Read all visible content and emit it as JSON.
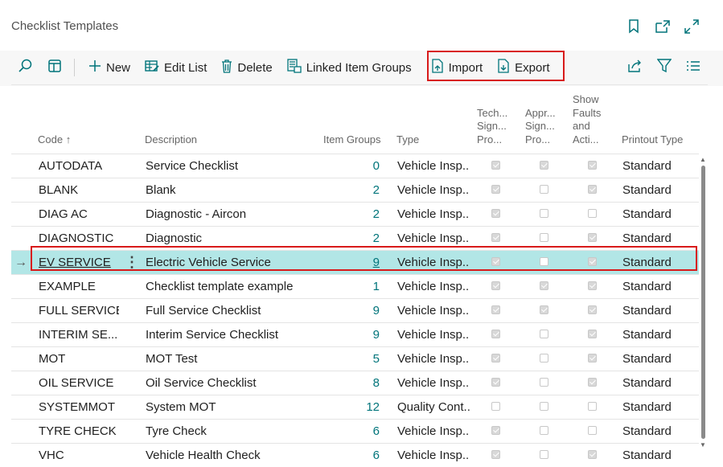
{
  "page": {
    "title": "Checklist Templates"
  },
  "title_icons": [
    "bookmark-icon",
    "open-new-window-icon",
    "expand-icon"
  ],
  "toolbar": {
    "new_label": "New",
    "edit_list_label": "Edit List",
    "delete_label": "Delete",
    "linked_item_groups_label": "Linked Item Groups",
    "import_label": "Import",
    "export_label": "Export"
  },
  "columns": {
    "code": "Code ↑",
    "description": "Description",
    "item_groups": "Item Groups",
    "type": "Type",
    "tech_sign": [
      "Tech...",
      "Sign...",
      "Pro..."
    ],
    "appr_sign": [
      "Appr...",
      "Sign...",
      "Pro..."
    ],
    "show_faults": [
      "Show",
      "Faults",
      "and",
      "Acti..."
    ],
    "printout_type": "Printout Type"
  },
  "rows": [
    {
      "code": "AUTODATA",
      "description": "Service Checklist",
      "item_groups": "0",
      "type": "Vehicle Insp...",
      "tech": true,
      "appr": true,
      "faults": true,
      "printout": "Standard"
    },
    {
      "code": "BLANK",
      "description": "Blank",
      "item_groups": "2",
      "type": "Vehicle Insp...",
      "tech": true,
      "appr": false,
      "faults": true,
      "printout": "Standard"
    },
    {
      "code": "DIAG AC",
      "description": "Diagnostic - Aircon",
      "item_groups": "2",
      "type": "Vehicle Insp...",
      "tech": true,
      "appr": false,
      "faults": false,
      "printout": "Standard"
    },
    {
      "code": "DIAGNOSTIC",
      "description": "Diagnostic",
      "item_groups": "2",
      "type": "Vehicle Insp...",
      "tech": true,
      "appr": false,
      "faults": true,
      "printout": "Standard"
    },
    {
      "code": "EV SERVICE",
      "description": "Electric Vehicle Service",
      "item_groups": "9",
      "type": "Vehicle Insp...",
      "tech": true,
      "appr": false,
      "faults": true,
      "printout": "Standard",
      "selected": true
    },
    {
      "code": "EXAMPLE",
      "description": "Checklist template example",
      "item_groups": "1",
      "type": "Vehicle Insp...",
      "tech": true,
      "appr": true,
      "faults": true,
      "printout": "Standard"
    },
    {
      "code": "FULL SERVICE",
      "description": "Full Service Checklist",
      "item_groups": "9",
      "type": "Vehicle Insp...",
      "tech": true,
      "appr": true,
      "faults": true,
      "printout": "Standard"
    },
    {
      "code": "INTERIM SE...",
      "description": "Interim Service Checklist",
      "item_groups": "9",
      "type": "Vehicle Insp...",
      "tech": true,
      "appr": false,
      "faults": true,
      "printout": "Standard"
    },
    {
      "code": "MOT",
      "description": "MOT Test",
      "item_groups": "5",
      "type": "Vehicle Insp...",
      "tech": true,
      "appr": false,
      "faults": true,
      "printout": "Standard"
    },
    {
      "code": "OIL SERVICE",
      "description": "Oil Service Checklist",
      "item_groups": "8",
      "type": "Vehicle Insp...",
      "tech": true,
      "appr": false,
      "faults": true,
      "printout": "Standard"
    },
    {
      "code": "SYSTEMMOT",
      "description": "System MOT",
      "item_groups": "12",
      "type": "Quality Cont...",
      "tech": false,
      "appr": false,
      "faults": false,
      "printout": "Standard"
    },
    {
      "code": "TYRE CHECK",
      "description": "Tyre Check",
      "item_groups": "6",
      "type": "Vehicle Insp...",
      "tech": true,
      "appr": false,
      "faults": false,
      "printout": "Standard"
    },
    {
      "code": "VHC",
      "description": "Vehicle Health Check",
      "item_groups": "6",
      "type": "Vehicle Insp...",
      "tech": true,
      "appr": false,
      "faults": true,
      "printout": "Standard"
    }
  ],
  "colors": {
    "accent": "#00747a",
    "selected_row": "#b2e6e6",
    "highlight_box": "#d81a1a"
  }
}
